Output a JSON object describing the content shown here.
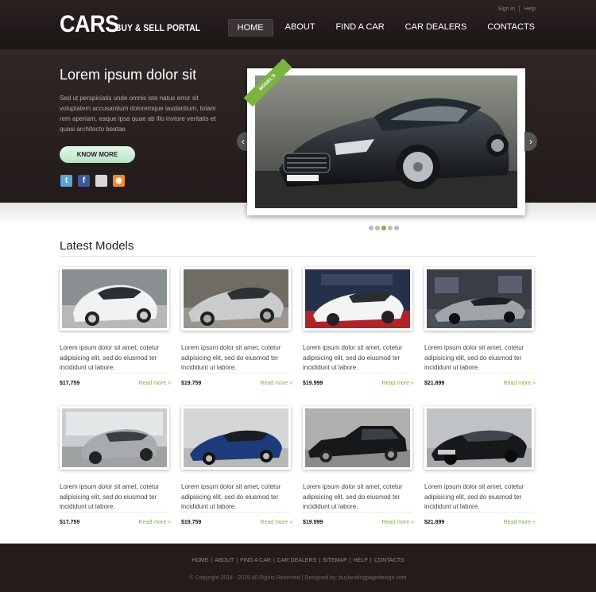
{
  "header": {
    "logo_main": "CARS",
    "logo_sub": "BUY & SELL PORTAL",
    "signin": "Sign in",
    "divider": "|",
    "help": "Help",
    "nav": [
      "HOME",
      "ABOUT",
      "FIND A CAR",
      "CAR DEALERS",
      "CONTACTS"
    ],
    "active_nav": "HOME"
  },
  "hero": {
    "title": "Lorem ipsum dolor sit",
    "text": "Sed ut perspiciatis unde omnis iste natus error sit voluptatem accusantium doloremque laudantium, totam rem aperiam, eaque ipsa quae ab illo invtore veritatis et quasi architecto beatae.",
    "button": "KNOW MORE",
    "ribbon": "MODEL'S",
    "social_icons": [
      "twitter-icon",
      "facebook-icon",
      "mail-icon",
      "rss-icon"
    ],
    "slide_count": 5,
    "active_slide": 3
  },
  "latest": {
    "title": "Latest Models",
    "cards": [
      {
        "text": "Lorem ipsum dolor sit amet, cotetur adipisicing elit, sed do eiusmod ter incididunt ut labore.",
        "price": "$17.759",
        "link": "Read more »"
      },
      {
        "text": "Lorem ipsum dolor sit amet, cotetur adipisicing elit, sed do eiusmod ter incididunt ut labore.",
        "price": "$19.759",
        "link": "Read more »"
      },
      {
        "text": "Lorem ipsum dolor sit amet, cotetur adipisicing elit, sed do eiusmod ter incididunt ut labore.",
        "price": "$19.999",
        "link": "Read more »"
      },
      {
        "text": "Lorem ipsum dolor sit amet, cotetur adipisicing elit, sed do eiusmod ter incididunt ut labore.",
        "price": "$21.899",
        "link": "Read more »"
      },
      {
        "text": "Lorem ipsum dolor sit amet, cotetur adipisicing elit, sed do eiusmod ter incididunt ut labore.",
        "price": "$17.759",
        "link": "Read more »"
      },
      {
        "text": "Lorem ipsum dolor sit amet, cotetur adipisicing elit, sed do eiusmod ter incididunt ut labore.",
        "price": "$19.759",
        "link": "Read more »"
      },
      {
        "text": "Lorem ipsum dolor sit amet, cotetur adipisicing elit, sed do eiusmod ter incididunt ut labore.",
        "price": "$19.999",
        "link": "Read more »"
      },
      {
        "text": "Lorem ipsum dolor sit amet, cotetur adipisicing elit, sed do eiusmod ter incididunt ut labore.",
        "price": "$21.899",
        "link": "Read more »"
      }
    ]
  },
  "footer": {
    "links": [
      "HOME",
      "ABOUT",
      "FIND A CAR",
      "CAR DEALERS",
      "SITEMAP",
      "HELP",
      "CONTACTS"
    ],
    "separator": "|",
    "copyright": "© Copyright 2014 - 2015 All Rights Reserved | Designed by: buylandingpagedesign.com"
  },
  "colors": {
    "accent": "#7cb342",
    "header_bg": "#231c1b",
    "hero_bg": "#2b2423",
    "button_bg": "#d4f0dc"
  }
}
